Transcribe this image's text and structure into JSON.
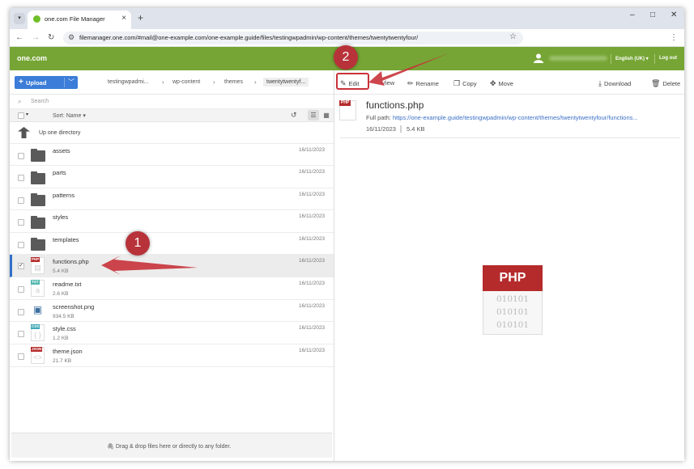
{
  "browser": {
    "tab_title": "one.com File Manager",
    "url": "filemanager.one.com/#mail@one-example.com/one-example.guide/files/testingwpadmin/wp-content/themes/twentytwentyfour/"
  },
  "app": {
    "logo": "one.com",
    "language": "English (UK)",
    "logout": "Log out"
  },
  "toolbar": {
    "upload": "Upload",
    "breadcrumb": [
      "testingwpadmi...",
      "wp-content",
      "themes",
      "twentytwentyf..."
    ],
    "edit": "Edit",
    "view": "View",
    "rename": "Rename",
    "copy": "Copy",
    "move": "Move",
    "download": "Download",
    "delete": "Delete"
  },
  "list": {
    "search_placeholder": "Search",
    "sort_label": "Sort: Name",
    "up_label": "Up one directory",
    "items": [
      {
        "name": "assets",
        "date": "16/11/2023"
      },
      {
        "name": "parts",
        "date": "16/11/2023"
      },
      {
        "name": "patterns",
        "date": "16/11/2023"
      },
      {
        "name": "styles",
        "date": "16/11/2023"
      },
      {
        "name": "templates",
        "date": "16/11/2023"
      },
      {
        "name": "functions.php",
        "size": "5.4 KB",
        "date": "16/11/2023",
        "tag": "PHP"
      },
      {
        "name": "readme.txt",
        "size": "2.6 KB",
        "date": "16/11/2023",
        "tag": "TXT"
      },
      {
        "name": "screenshot.png",
        "size": "934.5 KB",
        "date": "16/11/2023"
      },
      {
        "name": "style.css",
        "size": "1.2 KB",
        "date": "16/11/2023",
        "tag": "CSS"
      },
      {
        "name": "theme.json",
        "size": "21.7 KB",
        "date": "16/11/2023",
        "tag": "JSON"
      }
    ],
    "dropzone": "Drag & drop files here or directly to any folder."
  },
  "details": {
    "tag": "PHP",
    "name": "functions.php",
    "path_label": "Full path:",
    "path_url": "https://one-example.guide/testingwpadmin/wp-content/themes/twentytwentyfour/functions...",
    "date": "16/11/2023",
    "size": "5.4 KB",
    "preview_tag": "PHP",
    "preview_bits": [
      "010101",
      "010101",
      "010101"
    ]
  },
  "callouts": [
    "1",
    "2"
  ],
  "colors": {
    "brand_green": "#76a535",
    "upload_blue": "#3b7dd8",
    "php_red": "#b52b2b",
    "callout_red": "#b8323a"
  }
}
